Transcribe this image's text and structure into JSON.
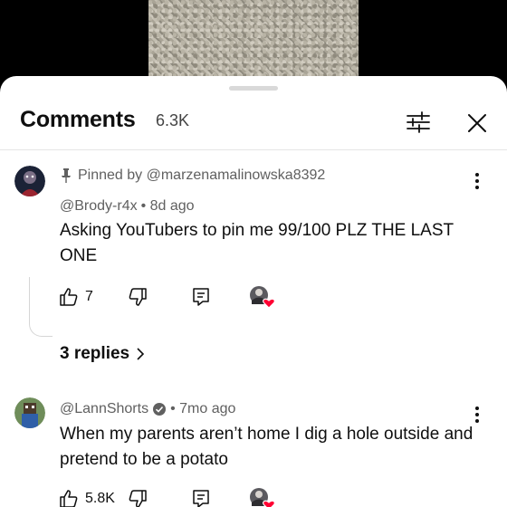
{
  "sheet": {
    "title": "Comments",
    "count": "6.3K"
  },
  "comments": [
    {
      "pinned_text": "Pinned by @marzenamalinowska8392",
      "author": "@Brody-r4x",
      "time": "• 8d ago",
      "text": "Asking YouTubers to pin me 99/100 PLZ THE LAST ONE",
      "likes": "7",
      "replies_label": "3 replies"
    },
    {
      "author": "@LannShorts",
      "time": "• 7mo ago",
      "text": "When my parents aren’t home I dig a hole outside and pretend to be a potato",
      "likes": "5.8K"
    }
  ],
  "icons": {
    "filter": "sliders-icon",
    "close": "close-icon",
    "pin": "pin-icon",
    "more": "more-vert-icon",
    "like": "thumb-up-icon",
    "dislike": "thumb-down-icon",
    "reply": "reply-icon",
    "creator_heart": "creator-heart-icon",
    "verified": "verified-check-icon"
  },
  "colors": {
    "heart": "#ff0033",
    "secondary_text": "#606060"
  }
}
